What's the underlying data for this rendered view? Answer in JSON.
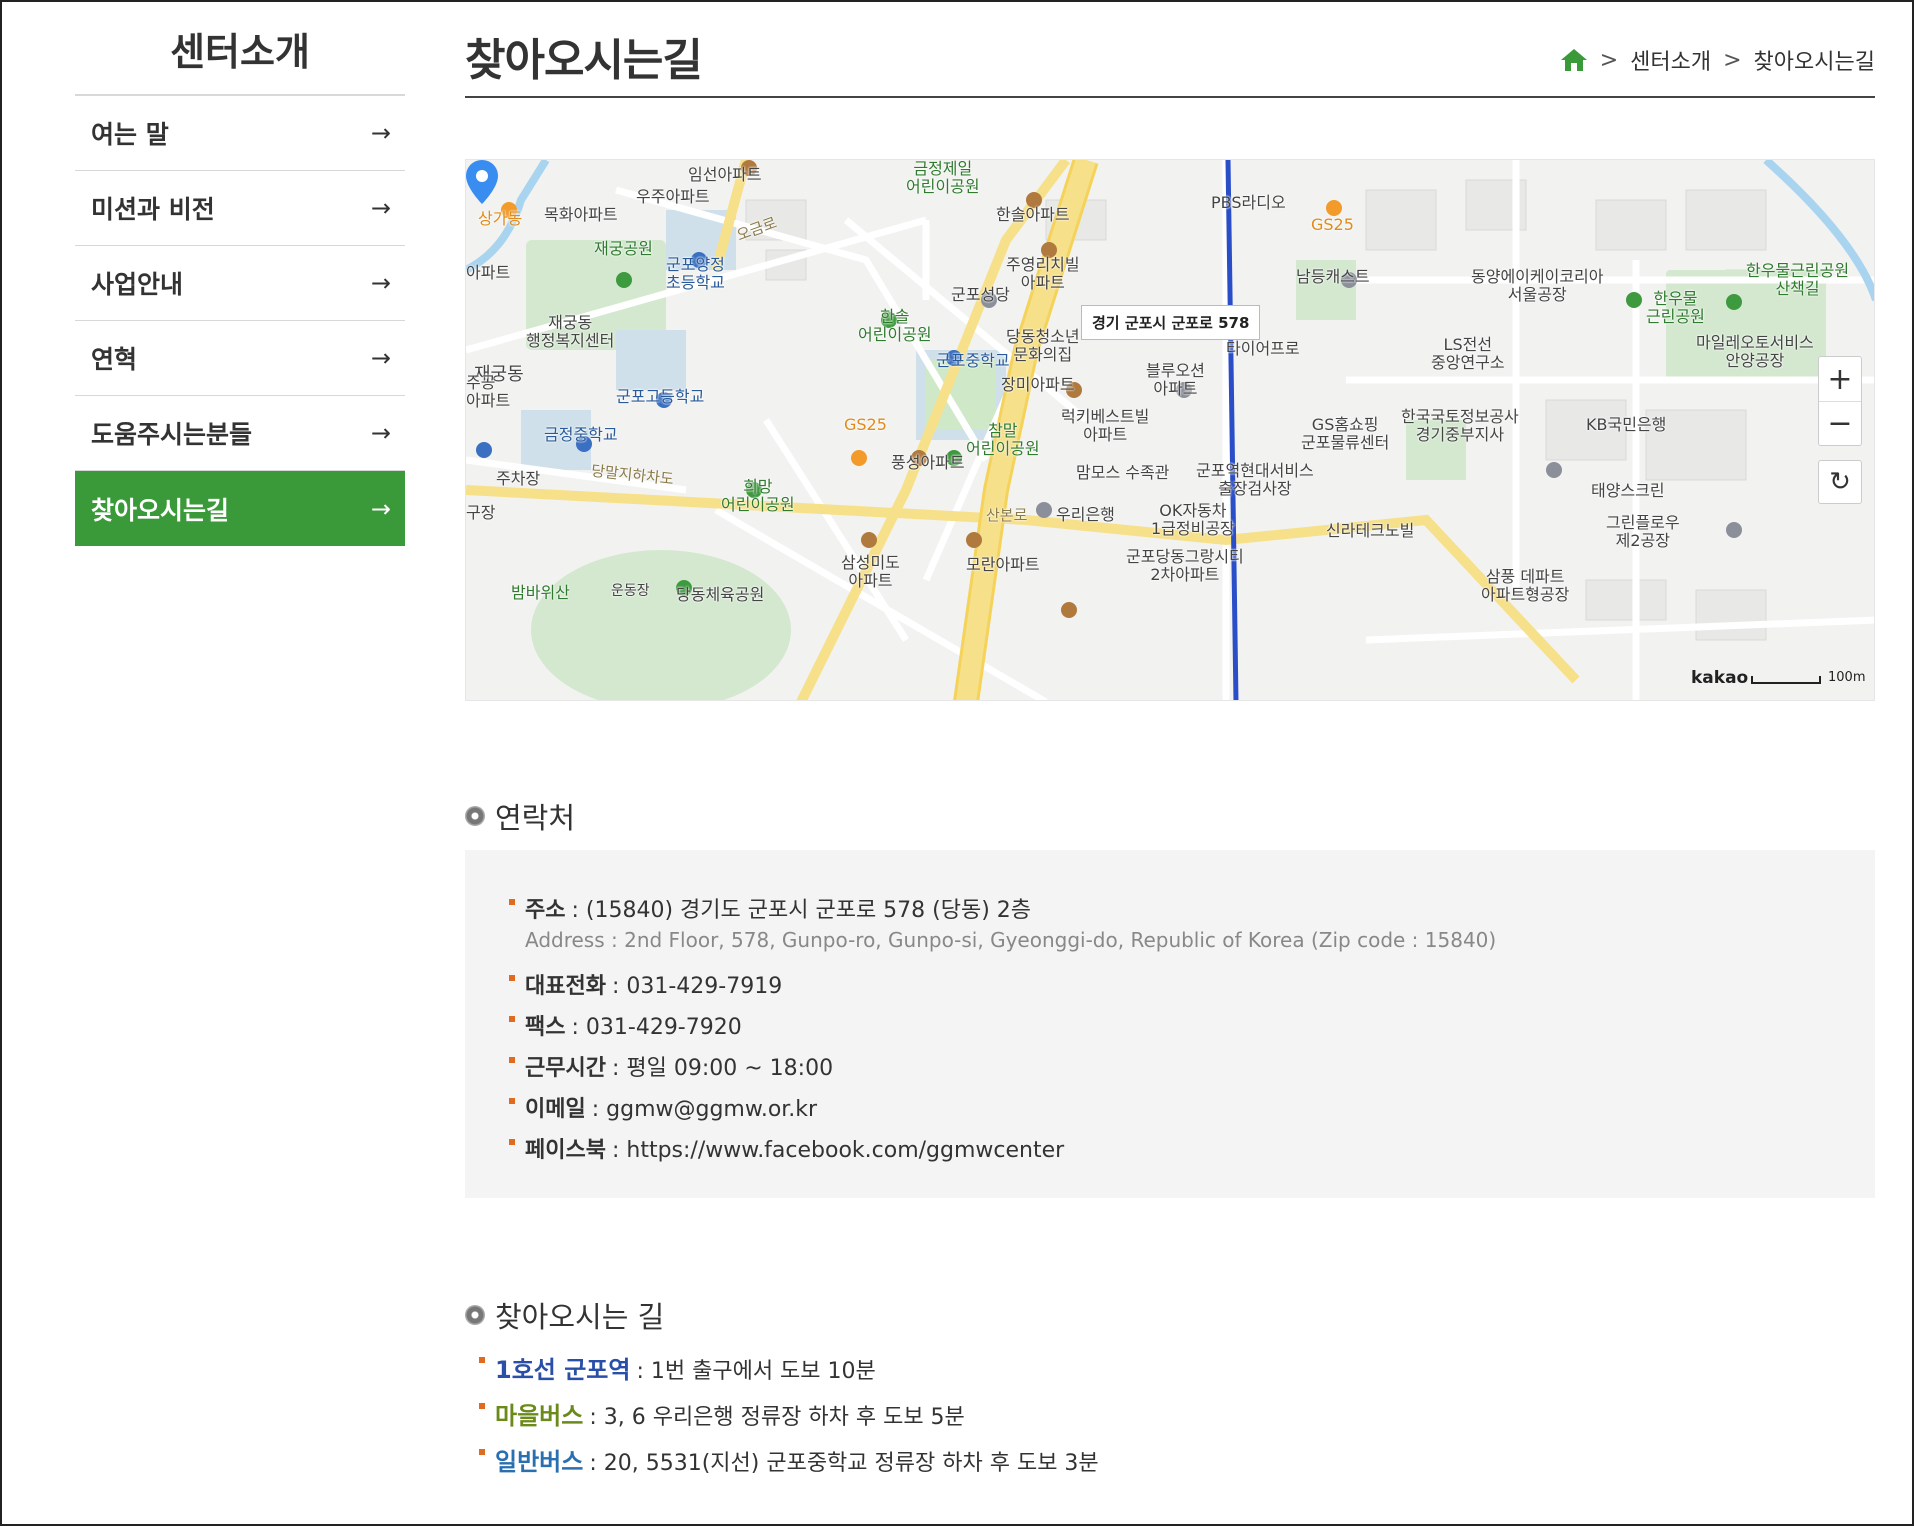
{
  "sidebar": {
    "title": "센터소개",
    "items": [
      {
        "label": "여는 말",
        "arrow": "→"
      },
      {
        "label": "미션과 비전",
        "arrow": "→"
      },
      {
        "label": "사업안내",
        "arrow": "→"
      },
      {
        "label": "연혁",
        "arrow": "→"
      },
      {
        "label": "도움주시는분들",
        "arrow": "→"
      },
      {
        "label": "찾아오시는길",
        "arrow": "→",
        "active": true
      }
    ]
  },
  "header": {
    "title": "찾아오시는길",
    "breadcrumb": [
      "센터소개",
      "찾아오시는길"
    ],
    "sep": ">",
    "home_icon": "home-icon"
  },
  "map": {
    "address_tooltip": "경기 군포시 군포로 578",
    "zoom_in": "+",
    "zoom_out": "−",
    "refresh": "↻",
    "logo": "kakao",
    "scale": "100m",
    "labels": {
      "l1": "임선아파트",
      "l2": "금정제일\n어린이공원",
      "l3": "PBS라디오",
      "l4": "GS25",
      "l5": "상가동",
      "l6": "목화아파트",
      "l7": "우주아파트",
      "l8": "한솔아파트",
      "l9": "재궁공원",
      "l10": "군포양정\n초등학교",
      "l11": "오금로",
      "l12": "주영리치빌\n아파트",
      "l13": "군포성당",
      "l14": "남등캐스트",
      "l15": "동양에이케이코리아\n서울공장",
      "l16": "한우물근린공원\n산책길",
      "l17": "한우물\n근린공원",
      "l18": "재궁동\n행정복지센터",
      "l19": "한솔\n어린이공원",
      "l20": "당동청소년\n문화의집",
      "l21": "타이어프로",
      "l22": "LS전선\n중앙연구소",
      "l23": "마일레오토서비스\n안양공장",
      "l24": "군포중학교",
      "l25": "블루오션\n아파트",
      "l26": "군포고등학교",
      "l27": "장미아파트",
      "l28": "럭키베스트빌\n아파트",
      "l29": "GS홈쇼핑\n군포물류센터",
      "l30": "한국국토정보공사\n경기중부지사",
      "l31": "KB국민은행",
      "l32": "금정중학교",
      "l33": "GS25",
      "l34": "참말\n어린이공원",
      "l35": "풍성아파트",
      "l36": "맘모스 수족관",
      "l37": "군포역현대서비스\n출장검사장",
      "l38": "주차장",
      "l39": "당말지하차도",
      "l40": "희망\n어린이공원",
      "l41": "태양스크린",
      "l42": "산본로",
      "l43": "우리은행",
      "l44": "OK자동차\n1급정비공장",
      "l45": "신라테크노빌",
      "l46": "그린플로우\n제2공장",
      "l47": "삼성미도\n아파트",
      "l48": "모란아파트",
      "l49": "군포당동그랑시티\n2차아파트",
      "l50": "밤바위산",
      "l51": "운동장",
      "l52": "당동체육공원",
      "l53": "삼풍 데파트\n아파트형공장",
      "l54": "재궁동",
      "l55": "아파트",
      "l56": "주공\n아파트",
      "l57": "구장"
    }
  },
  "contact": {
    "heading": "연락처",
    "address_key": "주소",
    "address_val": ": (15840) 경기도 군포시 군포로 578 (당동) 2층",
    "address_en": "Address : 2nd Floor, 578, Gunpo-ro, Gunpo-si, Gyeonggi-do, Republic of Korea (Zip code : 15840)",
    "tel_key": "대표전화",
    "tel_val": ": 031-429-7919",
    "fax_key": "팩스",
    "fax_val": ": 031-429-7920",
    "hours_key": "근무시간",
    "hours_val": ": 평일 09:00 ~ 18:00",
    "email_key": "이메일",
    "email_val": ": ggmw@ggmw.or.kr",
    "fb_key": "페이스북",
    "fb_val": ": https://www.facebook.com/ggmwcenter"
  },
  "directions": {
    "heading": "찾아오시는 길",
    "items": [
      {
        "key": "1호선 군포역",
        "val": ": 1번 출구에서 도보 10분",
        "color": "#2a4fa8"
      },
      {
        "key": "마을버스",
        "val": ": 3, 6 우리은행 정류장 하차 후 도보 5분",
        "color": "#6a8a1a"
      },
      {
        "key": "일반버스",
        "val": ": 20, 5531(지선) 군포중학교 정류장 하차 후 도보 3분",
        "color": "#2a6fb0"
      }
    ]
  },
  "colors": {
    "accent_green": "#3a9a3a",
    "bullet_orange": "#e06a20"
  }
}
